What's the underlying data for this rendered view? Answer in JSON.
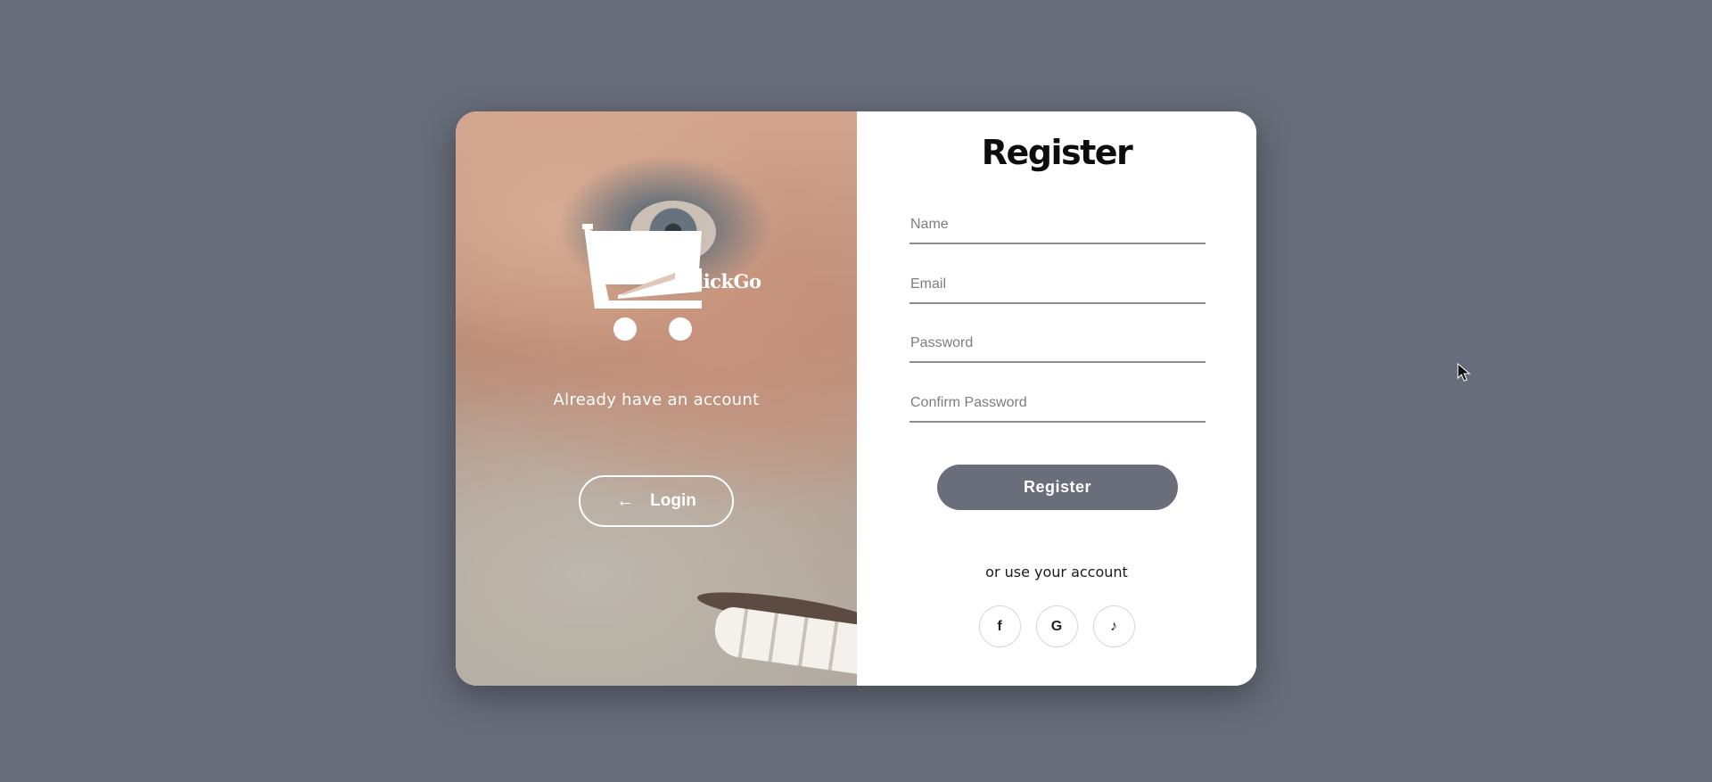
{
  "brand": {
    "name": "ClickGo"
  },
  "left_panel": {
    "caption": "Already have an account",
    "login_button_label": "Login",
    "login_button_icon": "arrow-left-icon"
  },
  "register_form": {
    "title": "Register",
    "fields": {
      "name_placeholder": "Name",
      "email_placeholder": "Email",
      "password_placeholder": "Password",
      "confirm_password_placeholder": "Confirm Password"
    },
    "submit_label": "Register",
    "alt_text": "or use your account",
    "social_buttons": [
      {
        "icon": "facebook-icon",
        "glyph": "f"
      },
      {
        "icon": "google-icon",
        "glyph": "G"
      },
      {
        "icon": "tiktok-icon",
        "glyph": "♪"
      }
    ]
  },
  "colors": {
    "page_background": "#686d7b",
    "register_button": "#6a6e7b",
    "card_background": "#ffffff"
  }
}
